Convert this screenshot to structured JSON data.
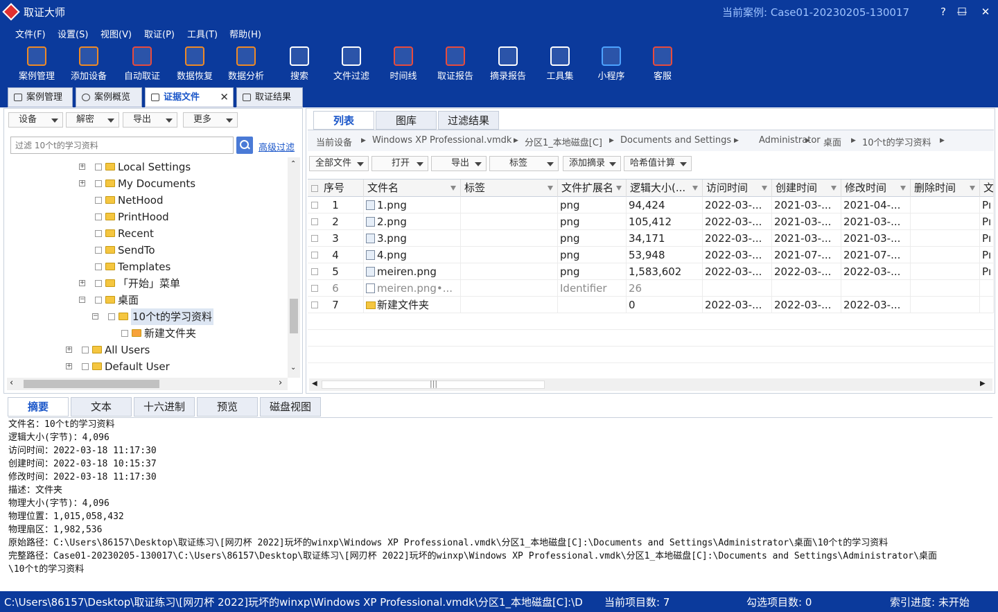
{
  "app": {
    "title": "取证大师",
    "case_label": "当前案例: Case01-20230205-130017"
  },
  "window_controls": {
    "help": "?",
    "minimize": "—",
    "maximize": "☐",
    "close": "✕"
  },
  "menu": [
    "文件(F)",
    "设置(S)",
    "视图(V)",
    "取证(P)",
    "工具(T)",
    "帮助(H)"
  ],
  "toolbar": [
    {
      "label": "案例管理",
      "icon": "case-manage-icon",
      "color": "#f08a24"
    },
    {
      "label": "添加设备",
      "icon": "add-device-icon",
      "color": "#f08a24"
    },
    {
      "label": "自动取证",
      "icon": "auto-forensics-icon",
      "color": "#e94b3c"
    },
    {
      "label": "数据恢复",
      "icon": "data-recovery-icon",
      "color": "#f08a24"
    },
    {
      "label": "数据分析",
      "icon": "data-analysis-icon",
      "color": "#f08a24"
    },
    {
      "label": "搜索",
      "icon": "search-doc-icon",
      "color": "#ffffff"
    },
    {
      "label": "文件过滤",
      "icon": "file-filter-icon",
      "color": "#ffffff"
    },
    {
      "label": "时间线",
      "icon": "timeline-icon",
      "color": "#e94b3c"
    },
    {
      "label": "取证报告",
      "icon": "forensic-report-icon",
      "color": "#e94b3c"
    },
    {
      "label": "摘录报告",
      "icon": "excerpt-report-icon",
      "color": "#ffffff"
    },
    {
      "label": "工具集",
      "icon": "toolset-icon",
      "color": "#ffffff"
    },
    {
      "label": "小程序",
      "icon": "mini-program-icon",
      "color": "#4da3ff"
    },
    {
      "label": "客服",
      "icon": "customer-service-icon",
      "color": "#e94b3c"
    }
  ],
  "doc_tabs": [
    {
      "label": "案例管理"
    },
    {
      "label": "案例概览"
    },
    {
      "label": "证据文件",
      "active": true
    },
    {
      "label": "取证结果"
    }
  ],
  "left": {
    "dropdowns": [
      "设备",
      "解密",
      "导出",
      "更多"
    ],
    "filter_placeholder": "过滤 10个t的学习资料",
    "advanced_filter": "高级过滤",
    "tree": [
      {
        "label": "Local Settings",
        "expander": "+"
      },
      {
        "label": "My Documents",
        "expander": "+"
      },
      {
        "label": "NetHood",
        "expander": ""
      },
      {
        "label": "PrintHood",
        "expander": ""
      },
      {
        "label": "Recent",
        "expander": ""
      },
      {
        "label": "SendTo",
        "expander": ""
      },
      {
        "label": "Templates",
        "expander": ""
      },
      {
        "label": "「开始」菜单",
        "expander": "+"
      },
      {
        "label": "桌面",
        "expander": "-"
      },
      {
        "label": "10个t的学习资料",
        "expander": "-",
        "selected": true
      },
      {
        "label": "新建文件夹",
        "expander": ""
      },
      {
        "label": "All Users",
        "expander": "+"
      },
      {
        "label": "Default User",
        "expander": "+"
      }
    ]
  },
  "right": {
    "view_tabs": [
      "列表",
      "图库",
      "过滤结果"
    ],
    "breadcrumb": [
      "当前设备",
      "Windows XP Professional.vmdk",
      "分区1_本地磁盘[C]",
      "Documents and Settings",
      "Administrator",
      "桌面",
      "10个t的学习资料"
    ],
    "tools": [
      "全部文件",
      "打开",
      "导出",
      "标签",
      "添加摘录",
      "哈希值计算"
    ],
    "columns": [
      "序号",
      "文件名",
      "标签",
      "文件扩展名",
      "逻辑大小(...",
      "访问时间",
      "创建时间",
      "修改时间",
      "删除时间",
      "文"
    ],
    "rows": [
      {
        "no": "1",
        "name": "1.png",
        "tag": "",
        "ext": "png",
        "size": "94,424",
        "atime": "2022-03-...",
        "ctime": "2021-03-...",
        "mtime": "2021-04-...",
        "dtime": "",
        "more": "Pı"
      },
      {
        "no": "2",
        "name": "2.png",
        "tag": "",
        "ext": "png",
        "size": "105,412",
        "atime": "2022-03-...",
        "ctime": "2021-03-...",
        "mtime": "2021-03-...",
        "dtime": "",
        "more": "Pı"
      },
      {
        "no": "3",
        "name": "3.png",
        "tag": "",
        "ext": "png",
        "size": "34,171",
        "atime": "2022-03-...",
        "ctime": "2021-03-...",
        "mtime": "2021-03-...",
        "dtime": "",
        "more": "Pı"
      },
      {
        "no": "4",
        "name": "4.png",
        "tag": "",
        "ext": "png",
        "size": "53,948",
        "atime": "2022-03-...",
        "ctime": "2021-07-...",
        "mtime": "2021-07-...",
        "dtime": "",
        "more": "Pı"
      },
      {
        "no": "5",
        "name": "meiren.png",
        "tag": "",
        "ext": "png",
        "size": "1,583,602",
        "atime": "2022-03-...",
        "ctime": "2022-03-...",
        "mtime": "2022-03-...",
        "dtime": "",
        "more": "Pı"
      },
      {
        "no": "6",
        "name": "meiren.png•...",
        "tag": "",
        "ext": "Identifier",
        "size": "26",
        "atime": "",
        "ctime": "",
        "mtime": "",
        "dtime": "",
        "more": "",
        "dim": true
      },
      {
        "no": "7",
        "name": "新建文件夹",
        "tag": "",
        "ext": "",
        "size": "0",
        "atime": "2022-03-...",
        "ctime": "2022-03-...",
        "mtime": "2022-03-...",
        "dtime": "",
        "more": "",
        "folder": true
      }
    ]
  },
  "bottom": {
    "tabs": [
      "摘要",
      "文本",
      "十六进制",
      "预览",
      "磁盘视图"
    ],
    "summary": [
      "文件名：10个t的学习资料",
      "逻辑大小(字节)：4,096",
      "访问时间：2022-03-18 11:17:30",
      "创建时间：2022-03-18 10:15:37",
      "修改时间：2022-03-18 11:17:30",
      "描述：文件夹",
      "物理大小(字节)：4,096",
      "物理位置：1,015,058,432",
      "物理扇区：1,982,536",
      "原始路径：C:\\Users\\86157\\Desktop\\取证练习\\[网刃杯 2022]玩坏的winxp\\Windows XP Professional.vmdk\\分区1_本地磁盘[C]:\\Documents and Settings\\Administrator\\桌面\\10个t的学习资料",
      "完整路径：Case01-20230205-130017\\C:\\Users\\86157\\Desktop\\取证练习\\[网刃杯 2022]玩坏的winxp\\Windows XP Professional.vmdk\\分区1_本地磁盘[C]:\\Documents and Settings\\Administrator\\桌面",
      "\\10个t的学习资料"
    ]
  },
  "status": {
    "path": "C:\\Users\\86157\\Desktop\\取证练习\\[网刃杯 2022]玩坏的winxp\\Windows XP Professional.vmdk\\分区1_本地磁盘[C]:\\D",
    "count": "当前项目数: 7",
    "checked": "勾选项目数: 0",
    "index": "索引进度: 未开始"
  }
}
